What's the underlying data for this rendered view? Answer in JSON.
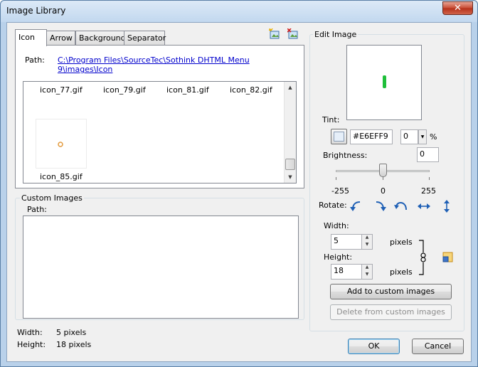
{
  "window": {
    "title": "Image Library",
    "close_glyph": "✕"
  },
  "tabs": [
    {
      "label": "Icon"
    },
    {
      "label": "Arrow"
    },
    {
      "label": "Background"
    },
    {
      "label": "Separator"
    }
  ],
  "library": {
    "path_label": "Path:",
    "path_value": "C:\\Program Files\\SourceTec\\Sothink DHTML Menu 9\\images\\Icon",
    "icons": [
      {
        "name": "icon_77.gif"
      },
      {
        "name": "icon_79.gif"
      },
      {
        "name": "icon_81.gif"
      },
      {
        "name": "icon_82.gif"
      },
      {
        "name": "icon_85.gif"
      }
    ]
  },
  "custom": {
    "group_label": "Custom Images",
    "path_label": "Path:"
  },
  "info": {
    "width_label": "Width:",
    "width_value": "5 pixels",
    "height_label": "Height:",
    "height_value": "18 pixels"
  },
  "edit": {
    "group_label": "Edit Image",
    "tint_label": "Tint:",
    "tint_color": "#E6EFF9",
    "tint_percent": "0",
    "percent_sign": "%",
    "brightness_label": "Brightness:",
    "brightness_value": "0",
    "slider": {
      "min_label": "-255",
      "mid_label": "0",
      "max_label": "255",
      "value": 0,
      "min": -255,
      "max": 255
    },
    "rotate_label": "Rotate:",
    "width_label": "Width:",
    "width_value": "5",
    "height_label": "Height:",
    "height_value": "18",
    "pixels_label_1": "pixels",
    "pixels_label_2": "pixels",
    "add_button": "Add to custom images",
    "delete_button": "Delete from custom images"
  },
  "footer": {
    "ok": "OK",
    "cancel": "Cancel"
  },
  "colors": {
    "accent": "#0000cc",
    "preview_shape": "#1fbf3a",
    "icon_ring": "#e39a3c"
  }
}
